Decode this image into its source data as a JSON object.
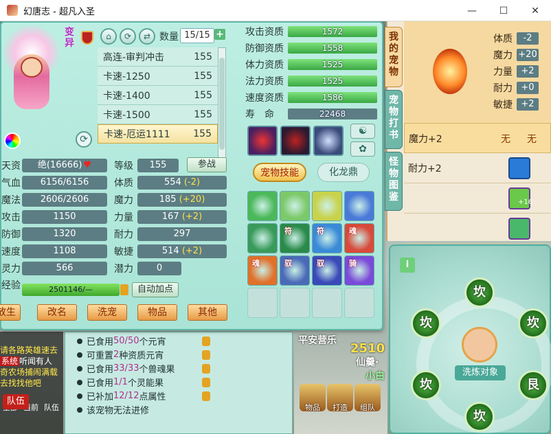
{
  "window": {
    "title": "幻唐志 - 超凡入圣",
    "minimize": "—",
    "maximize": "☐",
    "close": "✕"
  },
  "pet": {
    "badge": "变异",
    "count_label": "数量",
    "count_value": "15/15",
    "list": [
      {
        "name": "高连-审判冲击",
        "level": "155"
      },
      {
        "name": "卡速-1250",
        "level": "155"
      },
      {
        "name": "卡速-1400",
        "level": "155"
      },
      {
        "name": "卡速-1500",
        "level": "155"
      },
      {
        "name": "卡速-厄运1111",
        "level": "155",
        "selected": true
      }
    ]
  },
  "stats": {
    "tianzi": {
      "label": "天资",
      "value": "绝(16666)"
    },
    "level": {
      "label": "等级",
      "value": "155"
    },
    "battle_button": "参战",
    "hp": {
      "label": "气血",
      "value": "6156/6156"
    },
    "tizhi": {
      "label": "体质",
      "value": "554",
      "bonus": "(-2)"
    },
    "mp": {
      "label": "魔法",
      "value": "2606/2606"
    },
    "moli": {
      "label": "魔力",
      "value": "185",
      "bonus": "(+20)"
    },
    "attack": {
      "label": "攻击",
      "value": "1150"
    },
    "liliang": {
      "label": "力量",
      "value": "167",
      "bonus": "(+2)"
    },
    "defense": {
      "label": "防御",
      "value": "1320"
    },
    "naili": {
      "label": "耐力",
      "value": "297"
    },
    "speed": {
      "label": "速度",
      "value": "1108"
    },
    "minjie": {
      "label": "敏捷",
      "value": "514",
      "bonus": "(+2)"
    },
    "spirit": {
      "label": "灵力",
      "value": "566"
    },
    "potential": {
      "label": "潜力",
      "value": "0"
    },
    "exp": {
      "label": "经验",
      "value": "2501146/—",
      "fraction": 1.0
    },
    "auto_add_button": "自动加点"
  },
  "bottom_buttons": [
    "放生",
    "改名",
    "洗宠",
    "物品",
    "其他"
  ],
  "aptitude": [
    {
      "label": "攻击资质",
      "value": "1572"
    },
    {
      "label": "防御资质",
      "value": "1558"
    },
    {
      "label": "体力资质",
      "value": "1525"
    },
    {
      "label": "法力资质",
      "value": "1525"
    },
    {
      "label": "速度资质",
      "value": "1586"
    },
    {
      "label": "寿　命",
      "value": "22468"
    }
  ],
  "skill_tabs": {
    "active": "宠物技能",
    "inactive": "化龙鼎"
  },
  "skills": [
    {
      "tag": "",
      "color": "#4bb85a"
    },
    {
      "tag": "",
      "color": "#7cc96a"
    },
    {
      "tag": "",
      "color": "#c8d24a"
    },
    {
      "tag": "",
      "color": "#4a7ad8"
    },
    {
      "tag": "",
      "color": "#3a9a5a"
    },
    {
      "tag": "符",
      "color": "#2a8a4a"
    },
    {
      "tag": "符",
      "color": "#3a8ad8"
    },
    {
      "tag": "魂",
      "color": "#d84a3a"
    },
    {
      "tag": "魂",
      "color": "#e0702a"
    },
    {
      "tag": "驭",
      "color": "#4a6ab8"
    },
    {
      "tag": "驭",
      "color": "#3a4ab8"
    },
    {
      "tag": "骑",
      "color": "#7a4ad8"
    }
  ],
  "side_tabs": [
    "我的宠物",
    "宠物打书",
    "怪物图鉴"
  ],
  "side_stats": [
    {
      "label": "体质",
      "value": "-2"
    },
    {
      "label": "魔力",
      "value": "+20"
    },
    {
      "label": "力量",
      "value": "+2"
    },
    {
      "label": "耐力",
      "value": "+0"
    },
    {
      "label": "敏捷",
      "value": "+2"
    }
  ],
  "side_rows": [
    {
      "text": "魔力+2",
      "c1": "无",
      "c2": "无"
    },
    {
      "text": "耐力+2"
    },
    {
      "text": "",
      "icon_label": "+16"
    },
    {
      "text": ""
    }
  ],
  "wash": {
    "glyph": "坎",
    "glyph_alt": "艮",
    "target_label": "洗炼对象"
  },
  "info_lines": [
    {
      "pre": "已食用",
      "num": "50/50",
      "post": "个元宵"
    },
    {
      "pre": "可重置",
      "num": "2",
      "post": "种资质元宵"
    },
    {
      "pre": "已食用",
      "num": "33/33",
      "post": "个兽魂果"
    },
    {
      "pre": "已食用",
      "num": "1/1",
      "post": "个灵能果"
    },
    {
      "pre": "已补加",
      "num": "12/12",
      "post": "点属性"
    },
    {
      "pre": "该宠物无法进修",
      "num": "",
      "post": ""
    }
  ],
  "chat": {
    "line1": "请各路英雄速去",
    "tag": "系统",
    "line2": "听闻有人",
    "line3": "奇农场捕闹满载",
    "line4": "去找找他吧",
    "tabs": [
      "全部",
      "当前",
      "队伍"
    ],
    "team_button": "队伍"
  },
  "scene": {
    "text1": "平安营乐",
    "number": "2510",
    "text2": "仙羹·",
    "text3": "小白"
  },
  "bottom_icons": [
    "物品",
    "打造",
    "组队"
  ]
}
